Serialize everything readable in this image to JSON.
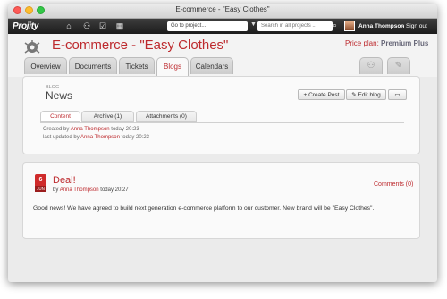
{
  "window": {
    "title": "E-commerce - \"Easy Clothes\""
  },
  "topbar": {
    "logo": "Projity",
    "nav_icons": [
      "home-icon",
      "people-icon",
      "tasks-icon",
      "calendar-icon"
    ],
    "project_select": "Go to project...",
    "search_placeholder": "Search in all projects ...",
    "user_name": "Anna Thompson",
    "signout_text": "- Sign out"
  },
  "header": {
    "project_title": "E-commerce - \"Easy Clothes\"",
    "price_label": "Price plan:",
    "price_plan": "Premium Plus"
  },
  "tabs": [
    {
      "label": "Overview"
    },
    {
      "label": "Documents"
    },
    {
      "label": "Tickets"
    },
    {
      "label": "Blogs"
    },
    {
      "label": "Calendars"
    }
  ],
  "active_tab": "Blogs",
  "blog_panel": {
    "breadcrumb": "BLOG",
    "title": "News",
    "buttons": {
      "create": "Create Post",
      "edit": "Edit blog",
      "print": "print-icon"
    },
    "subtabs": [
      "Content",
      "Archive (1)",
      "Attachments (0)"
    ],
    "created_prefix": "Created by",
    "created_user": "Anna Thompson",
    "created_time": "today 20:23",
    "updated_prefix": "last updated by",
    "updated_user": "Anna Thompson",
    "updated_time": "today 20:23"
  },
  "post": {
    "day": "6",
    "month": "JUN",
    "title": "Deal!",
    "by": "by",
    "author": "Anna Thompson",
    "time": "today 20:27",
    "comments": "Comments (0)",
    "body": "Good news! We have agreed to build next generation e-commerce platform to our customer. New brand will be \"Easy Clothes\"."
  }
}
